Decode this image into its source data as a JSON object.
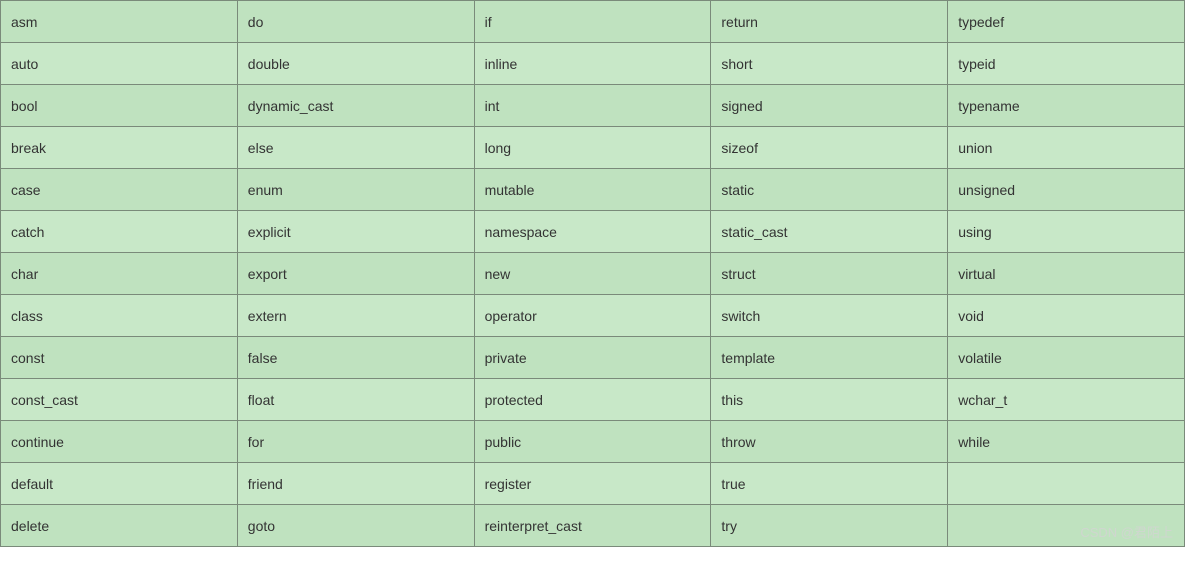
{
  "table": {
    "rows": [
      [
        "asm",
        "do",
        "if",
        "return",
        "typedef"
      ],
      [
        "auto",
        "double",
        "inline",
        "short",
        "typeid"
      ],
      [
        "bool",
        "dynamic_cast",
        "int",
        "signed",
        "typename"
      ],
      [
        "break",
        "else",
        "long",
        "sizeof",
        "union"
      ],
      [
        "case",
        "enum",
        "mutable",
        "static",
        "unsigned"
      ],
      [
        "catch",
        "explicit",
        "namespace",
        "static_cast",
        "using"
      ],
      [
        "char",
        "export",
        "new",
        "struct",
        "virtual"
      ],
      [
        "class",
        "extern",
        "operator",
        "switch",
        "void"
      ],
      [
        "const",
        "false",
        "private",
        "template",
        "volatile"
      ],
      [
        "const_cast",
        "float",
        "protected",
        "this",
        "wchar_t"
      ],
      [
        "continue",
        "for",
        "public",
        "throw",
        "while"
      ],
      [
        "default",
        "friend",
        "register",
        "true",
        ""
      ],
      [
        "delete",
        "goto",
        "reinterpret_cast",
        "try",
        ""
      ]
    ]
  },
  "watermark": "CSDN @君陌上"
}
